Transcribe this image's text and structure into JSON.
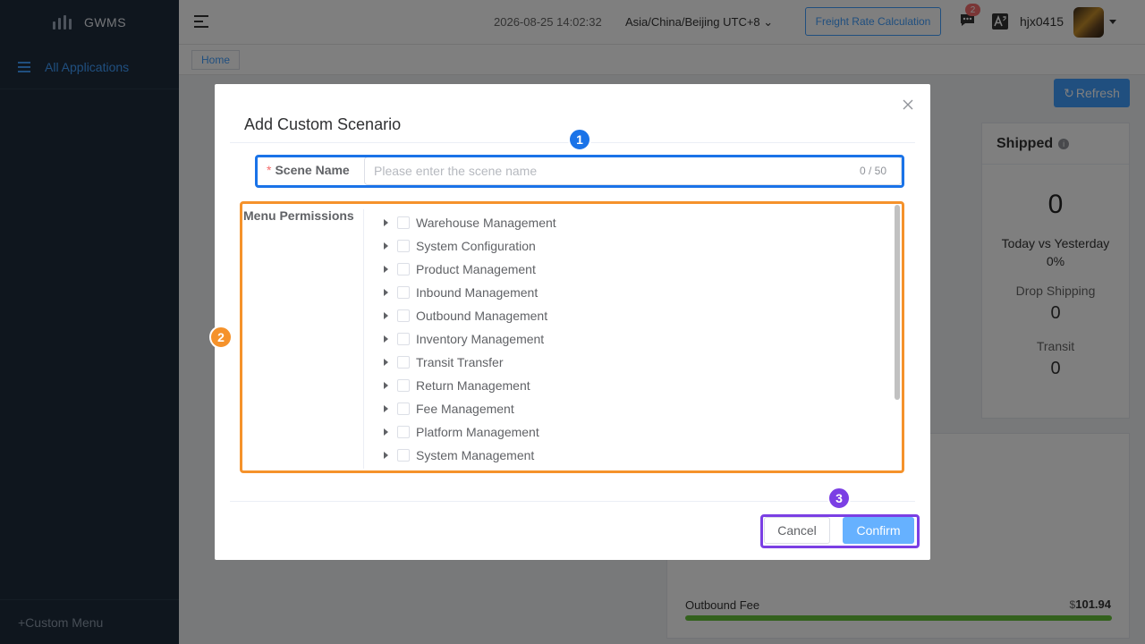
{
  "brand": {
    "name": "GWMS"
  },
  "sidebar": {
    "active_item": "All Applications",
    "custom_menu": "+Custom Menu"
  },
  "header": {
    "datetime": "2026-08-25 14:02:32",
    "timezone": "Asia/China/Beijing UTC+8",
    "freight_button": "Freight Rate Calculation",
    "message_badge": "2",
    "username": "hjx0415"
  },
  "tags": {
    "home": "Home"
  },
  "background": {
    "refresh_label": "Refresh",
    "shipped": {
      "title": "Shipped",
      "value": "0",
      "compare_label": "Today vs Yesterday",
      "compare_value": "0%",
      "drop_label": "Drop Shipping",
      "drop_value": "0",
      "transit_label": "Transit",
      "transit_value": "0"
    },
    "fee": {
      "label": "Outbound Fee",
      "currency": "$",
      "value": "101.94"
    }
  },
  "dialog": {
    "title": "Add Custom Scenario",
    "scene_label": "Scene Name",
    "scene_required": "*",
    "scene_placeholder": "Please enter the scene name",
    "scene_value": "",
    "scene_count": "0 / 50",
    "permissions_label": "Menu Permissions",
    "permissions": [
      "Warehouse Management",
      "System Configuration",
      "Product Management",
      "Inbound Management",
      "Outbound Management",
      "Inventory Management",
      "Transit Transfer",
      "Return Management",
      "Fee Management",
      "Platform Management",
      "System Management"
    ],
    "cancel_label": "Cancel",
    "confirm_label": "Confirm"
  },
  "annotations": {
    "m1": "1",
    "m2": "2",
    "m3": "3"
  },
  "colors": {
    "primary": "#409eff",
    "sidebar": "#1f2d3d",
    "marker1": "#1a73e8",
    "marker2": "#f5922b",
    "marker3": "#7b3fe4"
  }
}
